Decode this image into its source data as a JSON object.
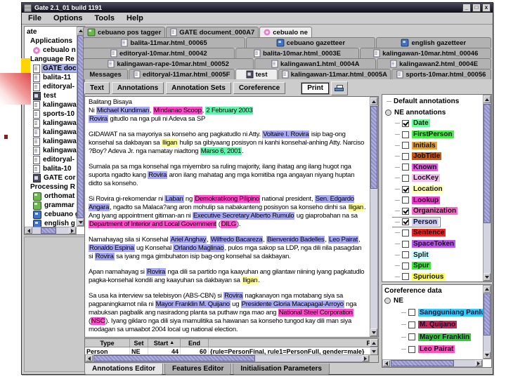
{
  "window": {
    "title": "Gate 2.1_01 build 1191"
  },
  "menu": {
    "items": [
      "File",
      "Options",
      "Tools",
      "Help"
    ]
  },
  "sidebar": {
    "items": [
      {
        "label": "ate",
        "depth": 0,
        "icon": null
      },
      {
        "label": "Applications",
        "depth": 1,
        "icon": null
      },
      {
        "label": "cebualo n",
        "depth": 2,
        "icon": "flower"
      },
      {
        "label": "Language Re",
        "depth": 1,
        "icon": null
      },
      {
        "label": "GATE doc",
        "depth": 2,
        "icon": "doc",
        "selected": true
      },
      {
        "label": "balita-11",
        "depth": 2,
        "icon": "doc"
      },
      {
        "label": "editoryal-",
        "depth": 2,
        "icon": "doc"
      },
      {
        "label": "test",
        "depth": 2,
        "icon": "book"
      },
      {
        "label": "kalingawa",
        "depth": 2,
        "icon": "doc"
      },
      {
        "label": "sports-10",
        "depth": 2,
        "icon": "doc"
      },
      {
        "label": "kalingawa",
        "depth": 2,
        "icon": "doc"
      },
      {
        "label": "kalingawa",
        "depth": 2,
        "icon": "doc"
      },
      {
        "label": "kalingawa",
        "depth": 2,
        "icon": "doc"
      },
      {
        "label": "kalingawa",
        "depth": 2,
        "icon": "doc"
      },
      {
        "label": "editoryal-",
        "depth": 2,
        "icon": "doc"
      },
      {
        "label": "balita-10",
        "depth": 2,
        "icon": "doc"
      },
      {
        "label": "GATE cor",
        "depth": 2,
        "icon": "book"
      },
      {
        "label": "Processing R",
        "depth": 1,
        "icon": null
      },
      {
        "label": "orthomat",
        "depth": 2,
        "icon": "pr"
      },
      {
        "label": "grammar",
        "depth": 2,
        "icon": "pr"
      },
      {
        "label": "cebuano g",
        "depth": 2,
        "icon": "gaz"
      },
      {
        "label": "english g",
        "depth": 2,
        "icon": "gaz"
      }
    ]
  },
  "tabs": {
    "rows": [
      {
        "fill": false,
        "tabs": [
          {
            "label": "cebuano pos tagger",
            "icon": "pr"
          },
          {
            "label": "GATE document_000A7",
            "icon": "doc"
          },
          {
            "label": "cebualo ne",
            "icon": "flower",
            "selected": true
          }
        ]
      },
      {
        "fill": true,
        "tabs": [
          {
            "label": "balita-11mar.html_00065",
            "icon": "doc",
            "w": 2.3
          },
          {
            "label": "cebuano gazetteer",
            "icon": "gaz",
            "w": 1.8
          },
          {
            "label": "english gazetteer",
            "icon": "gaz",
            "w": 1.6
          }
        ]
      },
      {
        "fill": true,
        "tabs": [
          {
            "label": "editoryal-10mar.html_00042",
            "icon": "doc",
            "w": 2.1
          },
          {
            "label": "balita-10mar.html_0003E",
            "icon": "doc",
            "w": 1.7
          },
          {
            "label": "kalingawan-10mar.html_00046",
            "icon": "doc",
            "w": 1.8
          }
        ]
      },
      {
        "fill": true,
        "tabs": [
          {
            "label": "kalingawan-rape-10mar.html_00052",
            "icon": "doc",
            "w": 2.3
          },
          {
            "label": "kalingawan1.html_0004A",
            "icon": "doc",
            "w": 1.6
          },
          {
            "label": "kalingawan2.html_0004E",
            "icon": "doc",
            "w": 1.5
          }
        ]
      },
      {
        "fill": true,
        "tabs": [
          {
            "label": "Messages",
            "icon": null,
            "w": 0.6
          },
          {
            "label": "editoryal-11mar.html_0005F",
            "icon": "doc",
            "w": 1.6
          },
          {
            "label": "test",
            "icon": "book",
            "selected": true,
            "w": 0.55
          },
          {
            "label": "kalingawan-11mar.html_0005A",
            "icon": "doc",
            "w": 1.7
          },
          {
            "label": "sports-10mar.html_00056",
            "icon": "doc",
            "w": 1.5
          }
        ]
      }
    ]
  },
  "toolbar": {
    "view_buttons": [
      "Text",
      "Annotations",
      "Annotation Sets",
      "Coreference"
    ],
    "print_label": "Print"
  },
  "highlight_colors": {
    "person": "#a9a9f2",
    "org": "#ff4ccb",
    "date": "#63f2ae",
    "loc": "#ffff9e"
  },
  "document": {
    "paragraphs": [
      {
        "gap": false,
        "s": [
          [
            "Balitang Bisaya",
            null
          ]
        ]
      },
      {
        "gap": false,
        "s": [
          [
            "Ni ",
            null
          ],
          [
            "Michael Kundiman",
            "person"
          ],
          [
            ", ",
            null
          ],
          [
            "Mindanao Scoop",
            "org"
          ],
          [
            ", ",
            null
          ],
          [
            "2 February 2003",
            "date"
          ]
        ]
      },
      {
        "gap": true,
        "s": [
          [
            "Rovira",
            "person"
          ],
          [
            " gitudlo na nga puli ni Adeva sa SP",
            null
          ]
        ]
      },
      {
        "gap": true,
        "s": [
          [
            "GIDAWAT na sa mayoriya sa konseho ang pagkatudlo ni Atty. ",
            null
          ],
          [
            "Voltaire I. Rovira",
            "person"
          ],
          [
            " isip bag-ong konsehal sa dakbayan sa ",
            null
          ],
          [
            "Iligan",
            "loc"
          ],
          [
            " hulip sa gibiyaang posisyon ni kanhi konsehal-anhing Atty. Narciso ?Boy? Adeva Jr. nga namatay niadtong ",
            null
          ],
          [
            "Marso 6, 2001",
            "date"
          ],
          [
            ".",
            null
          ]
        ]
      },
      {
        "gap": true,
        "s": [
          [
            "Sumala pa sa mga konsehal nga miyembro sa ruling majority, ilang ihatag ang ilang hugot nga suporta ngadto kang ",
            null
          ],
          [
            "Rovira",
            "person"
          ],
          [
            " aron ilang mahatag ang mga komitiba nga angayan niyang huptan didto sa konseho.",
            null
          ]
        ]
      },
      {
        "gap": true,
        "s": [
          [
            "Si Rovira gi-rekomendar ni ",
            null
          ],
          [
            "Laban",
            "person"
          ],
          [
            " ng ",
            null
          ],
          [
            "Demokratikong Pilipino",
            "org"
          ],
          [
            " national president, ",
            null
          ],
          [
            "Sen. Edgardo Angara",
            "person"
          ],
          [
            ", ngadto sa Malaca?ang aron mohulip sa nabakanteng posisyon sa konseho dinhi sa ",
            null
          ],
          [
            "Iligan",
            "loc"
          ],
          [
            ". Ang iyang appointment gitiman-an ni ",
            null
          ],
          [
            "Executive Secretary Alberto Rumulo",
            "person"
          ],
          [
            " ug giaprobahan na sa ",
            null
          ],
          [
            "Department of Interior and Local Government",
            "org"
          ],
          [
            " (",
            null
          ],
          [
            "DILG",
            "org"
          ],
          [
            ").",
            null
          ]
        ]
      },
      {
        "gap": true,
        "s": [
          [
            "Namahayag sila si Konsehal ",
            null
          ],
          [
            "Ariel Anghay",
            "person"
          ],
          [
            ", ",
            null
          ],
          [
            "Wilfredo Bacareza",
            "person"
          ],
          [
            ", ",
            null
          ],
          [
            "Bienvenido Badelles",
            "person"
          ],
          [
            ", ",
            null
          ],
          [
            "Leo Pairat",
            "person"
          ],
          [
            ", ",
            null
          ],
          [
            "Ronaldo Espina",
            "person"
          ],
          [
            " ug Konsehal ",
            null
          ],
          [
            "Orlando Maglinao",
            "person"
          ],
          [
            ", pulos mga sakop sa LDP, nga dili nila pasagdan si ",
            null
          ],
          [
            "Rovira",
            "person"
          ],
          [
            " sa iyang mga gimbuhaton isip bag-ong konsehal sa dakbayan.",
            null
          ]
        ]
      },
      {
        "gap": true,
        "s": [
          [
            "Apan namahayag si ",
            null
          ],
          [
            "Rovira",
            "person"
          ],
          [
            " nga dili sa partido nga kaayuhan ang gilantaw niining iyang pagkatudlo pagka-konsehal kondili ang kaayuhan sa dakbayan sa ",
            null
          ],
          [
            "Iligan",
            "loc"
          ],
          [
            ".",
            null
          ]
        ]
      },
      {
        "gap": false,
        "s": [
          [
            "Sa usa ka interview sa telebisyon (ABS-CBN) si ",
            null
          ],
          [
            "Rovira",
            "person"
          ],
          [
            " nagkanayon nga motabang siya sa pagpaningkamot nila ni ",
            null
          ],
          [
            "Mayor Franklin M. Quijano",
            "person"
          ],
          [
            " ug ",
            null
          ],
          [
            "Presidente Gloria Macapagal-Arroyo",
            "person"
          ],
          [
            " nga mabuksan pagbalik ang nasiradong planta sa puthaw nga mao ang ",
            null
          ],
          [
            "National Steel Corporation",
            "org"
          ],
          [
            " (",
            null
          ],
          [
            "NSC",
            "org"
          ],
          [
            "). Iyang giklaro nga dili siya mamulitika sa hawanan sa konseho tungod kay dili man siya modagan sa umaabot 2004 local ug national election.",
            null
          ]
        ]
      }
    ]
  },
  "annotation_table": {
    "headers": [
      {
        "label": "Type",
        "w": 64
      },
      {
        "label": "Set",
        "w": 26
      },
      {
        "label": "Start",
        "w": 46,
        "sort": "▲"
      },
      {
        "label": "End",
        "w": 40
      },
      {
        "label": "Fea",
        "w": 0,
        "align": "right"
      }
    ],
    "rows": [
      [
        "Person",
        "NE",
        "44",
        "60",
        "{rule=PersonFinal, rule1=PersonFull, gender=male}"
      ]
    ]
  },
  "bottom_tabs": {
    "items": [
      {
        "label": "Annotations Editor",
        "selected": true
      },
      {
        "label": "Features Editor",
        "selected": false
      },
      {
        "label": "Initialisation Parameters",
        "selected": false
      }
    ]
  },
  "annotations_panel": {
    "root_label": "Default annotations",
    "group_label": "NE annotations",
    "items": [
      {
        "label": "Date",
        "color": "#66ff99",
        "checked": true
      },
      {
        "label": "FirstPerson",
        "color": "#44ee44",
        "checked": false
      },
      {
        "label": "Initials",
        "color": "#e2a33d",
        "checked": false
      },
      {
        "label": "JobTitle",
        "color": "#d45500",
        "checked": false
      },
      {
        "label": "Known",
        "color": "#ee55ee",
        "checked": false
      },
      {
        "label": "LocKey",
        "color": "#f2c0ee",
        "checked": false
      },
      {
        "label": "Location",
        "color": "#ffffbb",
        "checked": true
      },
      {
        "label": "Lookup",
        "color": "#ee3fd0",
        "checked": false
      },
      {
        "label": "Organization",
        "color": "#ff66cc",
        "checked": true
      },
      {
        "label": "Person",
        "color": "#ccccff",
        "checked": true,
        "focused": true
      },
      {
        "label": "Sentence",
        "color": "#ee2222",
        "checked": false
      },
      {
        "label": "SpaceToken",
        "color": "#bb55ee",
        "checked": false
      },
      {
        "label": "Split",
        "color": "#ccffff",
        "checked": false
      },
      {
        "label": "Spur",
        "color": "#33ee33",
        "checked": false
      },
      {
        "label": "Spurious",
        "color": "#ffff44",
        "checked": false
      }
    ]
  },
  "coreference_panel": {
    "title": "Coreference data",
    "group_label": "NE",
    "items": [
      {
        "label": "Sangguniang Panlung",
        "color": "#33ccff"
      },
      {
        "label": "M. Quijano",
        "color": "#cc2255"
      },
      {
        "label": "Mayor Franklin",
        "color": "#33cc33"
      },
      {
        "label": "Leo Pairat",
        "color": "#ff55bb"
      }
    ]
  }
}
